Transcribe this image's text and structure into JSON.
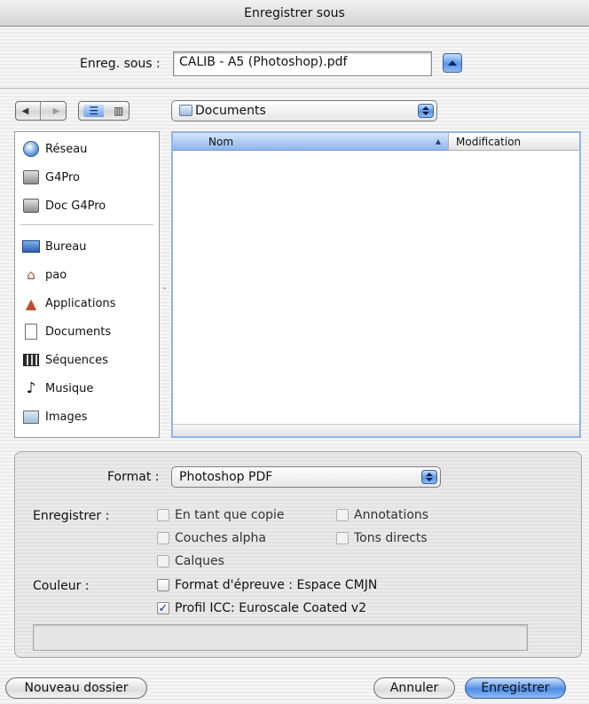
{
  "window": {
    "title": "Enregistrer sous"
  },
  "save_as": {
    "label": "Enreg. sous :",
    "value": "CALIB - A5 (Photoshop).pdf"
  },
  "toolbar": {
    "back_glyph": "◀",
    "forward_glyph": "▶",
    "list_view_glyph": "☰",
    "column_view_glyph": "▥",
    "location": "Documents"
  },
  "sidebar": {
    "devices": [
      {
        "label": "Réseau",
        "icon": "network-icon"
      },
      {
        "label": "G4Pro",
        "icon": "hard-disk-icon"
      },
      {
        "label": "Doc G4Pro",
        "icon": "hard-disk-icon"
      }
    ],
    "places": [
      {
        "label": "Bureau",
        "icon": "desktop-icon"
      },
      {
        "label": "pao",
        "icon": "home-icon"
      },
      {
        "label": "Applications",
        "icon": "applications-icon"
      },
      {
        "label": "Documents",
        "icon": "documents-icon"
      },
      {
        "label": "Séquences",
        "icon": "movies-icon"
      },
      {
        "label": "Musique",
        "icon": "music-icon"
      },
      {
        "label": "Images",
        "icon": "pictures-icon"
      }
    ]
  },
  "browser": {
    "columns": [
      {
        "label": "Nom",
        "sorted": true
      },
      {
        "label": "Modification",
        "sorted": false
      }
    ]
  },
  "options": {
    "format_label": "Format :",
    "format_value": "Photoshop PDF",
    "enregistrer_label": "Enregistrer :",
    "checkboxes": [
      {
        "label": "En tant que copie",
        "checked": false
      },
      {
        "label": "Annotations",
        "checked": false
      },
      {
        "label": "Couches alpha",
        "checked": false
      },
      {
        "label": "Tons directs",
        "checked": false
      },
      {
        "label": "Calques",
        "checked": false
      }
    ],
    "couleur_label": "Couleur :",
    "proof_format": {
      "label": "Format d'épreuve : Espace CMJN",
      "checked": false
    },
    "icc_profile": {
      "label": "Profil ICC:  Euroscale Coated v2",
      "checked": true
    },
    "message": ""
  },
  "buttons": {
    "new_folder": "Nouveau dossier",
    "cancel": "Annuler",
    "save": "Enregistrer"
  },
  "colors": {
    "selection_blue": "#5b95e6",
    "browser_border": "#8fb4e8"
  }
}
